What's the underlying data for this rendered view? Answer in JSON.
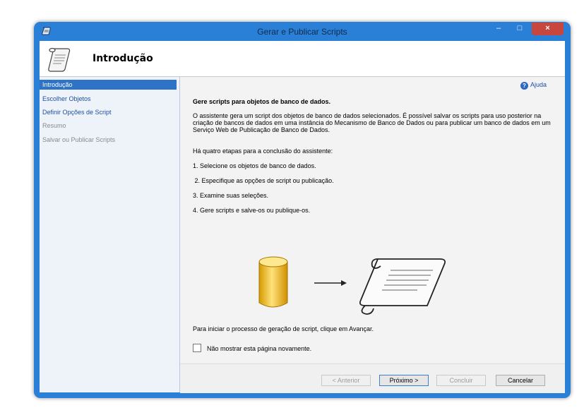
{
  "window": {
    "title": "Gerar e Publicar Scripts",
    "controls": {
      "minimize": "–",
      "maximize": "□",
      "close": "×"
    },
    "colors": {
      "frame": "#2a7fd6",
      "close": "#c7463e",
      "selection": "#2e73c6"
    }
  },
  "header": {
    "title": "Introdução",
    "icon": "script-scroll-icon"
  },
  "sidebar": {
    "items": [
      {
        "label": "Introdução",
        "state": "active"
      },
      {
        "label": "Escolher Objetos",
        "state": "link"
      },
      {
        "label": "Definir Opções de Script",
        "state": "link"
      },
      {
        "label": "Resumo",
        "state": "disabled"
      },
      {
        "label": "Salvar ou Publicar Scripts",
        "state": "disabled"
      }
    ]
  },
  "content": {
    "help_label": "Ajuda",
    "heading": "Gere scripts para objetos de banco de dados.",
    "description": "O assistente gera um script dos objetos de banco de dados selecionados. É possível salvar os scripts para uso posterior na criação de bancos de dados em uma instância do Mecanismo de Banco de Dados ou para publicar um banco de dados em um Serviço Web de Publicação de Banco de Dados.",
    "steps_intro": "Há quatro etapas para a conclusão do assistente:",
    "steps": [
      "1. Selecione os objetos de banco de dados.",
      " 2. Especifique as opções de script ou publicação.",
      "3. Examine suas seleções.",
      "4. Gere scripts e salve-os ou publique-os."
    ],
    "start_hint": "Para iniciar o processo de geração de script, clique em Avançar.",
    "checkbox_label": "Não mostrar esta página novamente.",
    "checkbox_checked": false
  },
  "footer": {
    "back_label": "< Anterior",
    "next_label": "Próximo >",
    "finish_label": "Concluir",
    "cancel_label": "Cancelar"
  }
}
